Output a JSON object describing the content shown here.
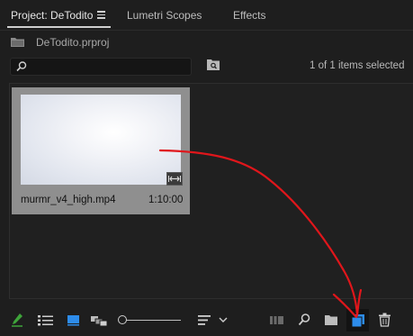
{
  "tabs": [
    {
      "label": "Project: DeTodito",
      "active": true
    },
    {
      "label": "Lumetri Scopes",
      "active": false
    },
    {
      "label": "Effects",
      "active": false
    }
  ],
  "project": {
    "filename": "DeTodito.prproj"
  },
  "search": {
    "placeholder": ""
  },
  "status": {
    "items_selected": "1 of 1 items selected"
  },
  "clip": {
    "name": "murmr_v4_high.mp4",
    "duration": "1:10:00"
  },
  "bottom_toolbar": {
    "icons": [
      "pencil-icon",
      "list-view-icon",
      "icon-view-icon",
      "freeform-view-icon",
      "zoom-slider",
      "sort-icon",
      "chevron-down-icon",
      "automate-to-sequence-icon",
      "find-icon",
      "new-bin-icon",
      "new-item-icon",
      "clear-trash-icon"
    ]
  },
  "colors": {
    "accent_blue": "#2d8ceb",
    "pencil_green": "#3ea53a",
    "annotation_red": "#e0161b"
  }
}
